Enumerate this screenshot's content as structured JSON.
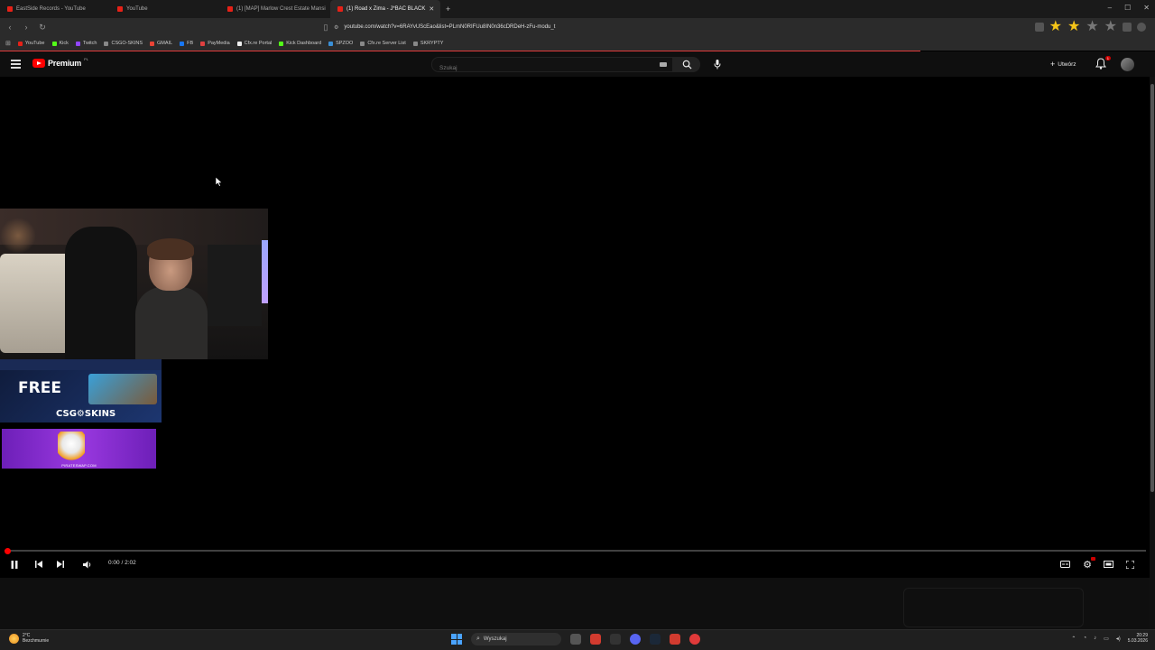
{
  "browser": {
    "tabs": [
      {
        "label": "EastSide Records - YouTube",
        "active": false
      },
      {
        "label": "YouTube",
        "active": false
      },
      {
        "label": "(1) [MAP] Marlow Crest Estate Mansi",
        "active": false
      },
      {
        "label": "(1) Road x Zima - J*BAC BLACK",
        "active": true
      }
    ],
    "new_tab": "+",
    "url": "youtube.com/watch?v=6RAYvUScEao&list=PLmN0RIFUu8IN0n36cDRDeH-zFu-modu_t",
    "bookmarks": [
      "YouTube",
      "Kick",
      "Twitch",
      "CSGO-SKINS",
      "GMAIL",
      "FB",
      "PayMedia",
      "Cfx.re Portal",
      "Kick Dashboard",
      "SPZOO",
      "Cfx.re Server List",
      "SKRYPTY"
    ],
    "window_controls": [
      "–",
      "☐",
      "✕"
    ]
  },
  "youtube": {
    "logo_text": "Premium",
    "logo_superscript": "PL",
    "search_placeholder": "Szukaj",
    "create_label": "Utwórz",
    "notification_count": "1"
  },
  "player": {
    "current_time": "0:00",
    "duration": "2:02",
    "time_display": "0:00 / 2:02",
    "progress": 0.0
  },
  "overlays": {
    "csgo_ad_free": "FREE",
    "csgo_ad_brand": "CSG⚙SKINS",
    "pirate_ad_domain": "PIRATESWAP.COM"
  },
  "taskbar": {
    "weather_temp": "2°C",
    "weather_desc": "Bezchmurnie",
    "search_label": "Wyszukaj",
    "time": "20:29",
    "date": "5.03.2026"
  },
  "colors": {
    "accent": "#ff0000",
    "windows_blue": "#4aa3ff"
  }
}
